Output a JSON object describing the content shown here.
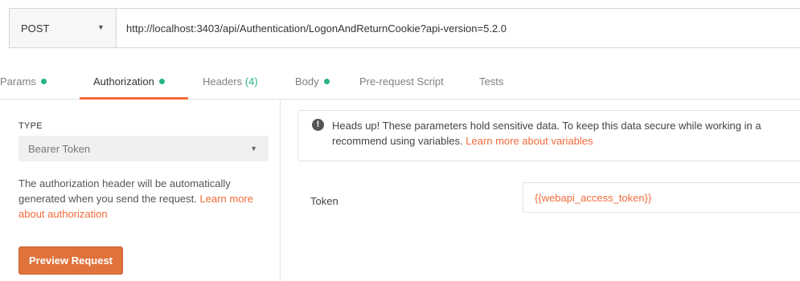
{
  "request": {
    "method": "POST",
    "url": "http://localhost:3403/api/Authentication/LogonAndReturnCookie?api-version=5.2.0"
  },
  "tabs": [
    {
      "label": "Params",
      "has_dot": true
    },
    {
      "label": "Authorization",
      "has_dot": true,
      "active": true
    },
    {
      "label": "Headers",
      "count": "(4)"
    },
    {
      "label": "Body",
      "has_dot": true
    },
    {
      "label": "Pre-request Script"
    },
    {
      "label": "Tests"
    }
  ],
  "auth": {
    "type_label": "TYPE",
    "type_value": "Bearer Token",
    "description": "The authorization header will be automatically generated when you send the request. ",
    "description_link": "Learn more about authorization",
    "preview_button": "Preview Request"
  },
  "notice": {
    "icon": "info-icon",
    "text_line1": "Heads up! These parameters hold sensitive data. To keep this data secure while working in a",
    "text_line2": "recommend using variables. ",
    "link": "Learn more about variables"
  },
  "token": {
    "label": "Token",
    "value": "{{webapi_access_token}}"
  },
  "colors": {
    "accent": "#f26b3a",
    "status_dot": "#26b47f",
    "button": "#e0723b"
  }
}
